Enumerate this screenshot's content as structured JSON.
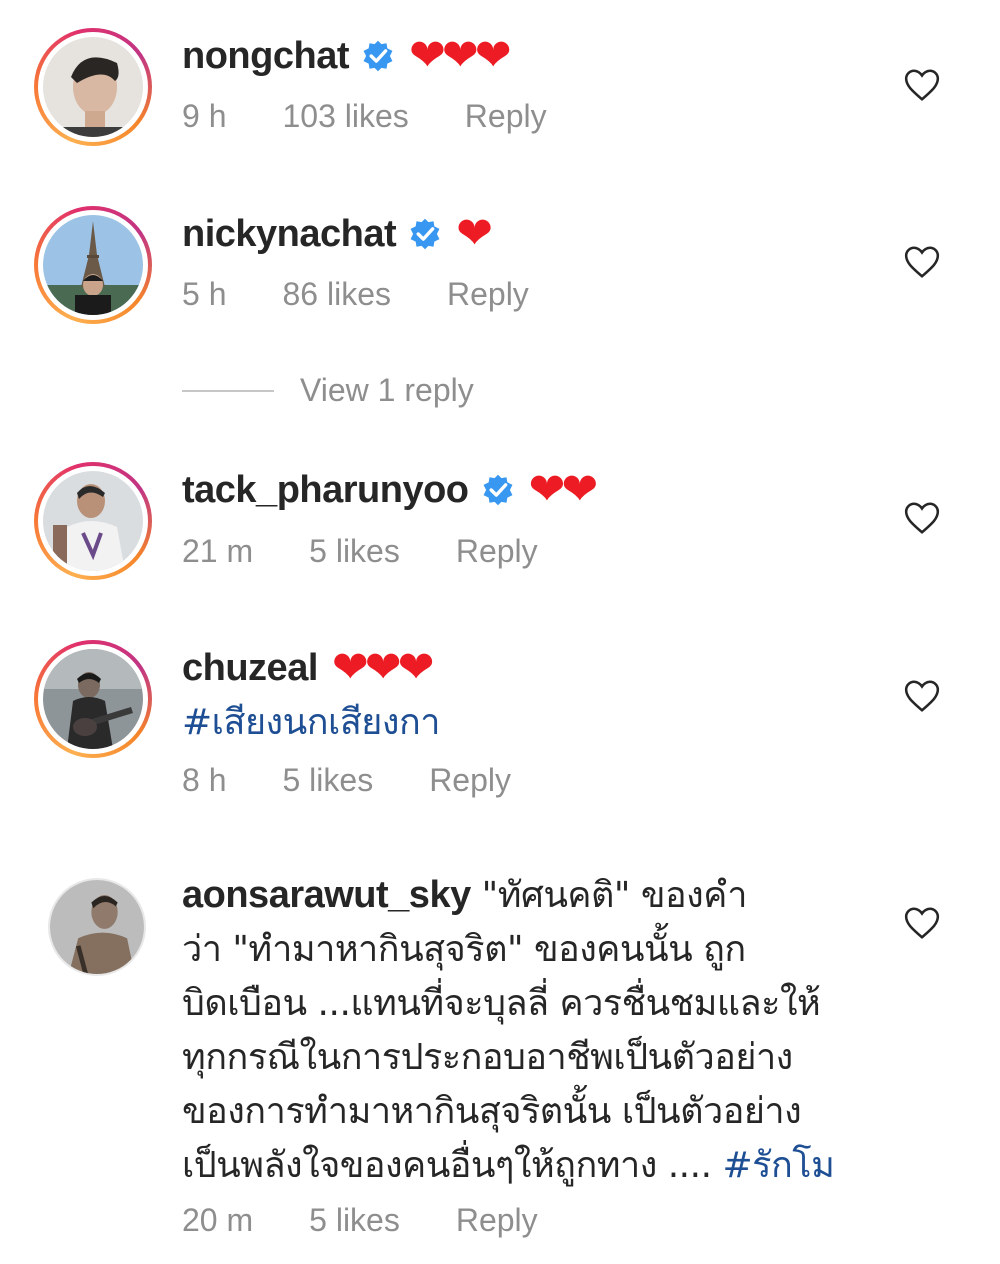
{
  "comments": [
    {
      "username": "nongchat",
      "verified": true,
      "text": "❤❤❤",
      "time": "9 h",
      "likes": "103 likes",
      "reply": "Reply"
    },
    {
      "username": "nickynachat",
      "verified": true,
      "text": "❤",
      "time": "5 h",
      "likes": "86 likes",
      "reply": "Reply",
      "view_replies": "View 1 reply"
    },
    {
      "username": "tack_pharunyoo",
      "verified": true,
      "text": "❤❤",
      "time": "21 m",
      "likes": "5 likes",
      "reply": "Reply"
    },
    {
      "username": "chuzeal",
      "verified": false,
      "text": "❤❤❤",
      "hashtag": "#เสียงนกเสียงกา",
      "time": "8 h",
      "likes": "5 likes",
      "reply": "Reply"
    },
    {
      "username": "aonsarawut_sky",
      "verified": false,
      "text_lines": [
        "\"ทัศนคติ\" ของคำ",
        "ว่า \"ทำมาหากินสุจริต\" ของคนนั้น ถูก",
        "บิดเบือน ...แทนที่จะบุลลี่ ควรชื่นชมและให้",
        "ทุกกรณีในการประกอบอาชีพเป็นตัวอย่าง",
        "ของการทำมาหากินสุจริตนั้น เป็นตัวอย่าง",
        "เป็นพลังใจของคนอื่นๆให้ถูกทาง .... "
      ],
      "hashtag": "#รักโม",
      "time": "20 m",
      "likes": "5 likes",
      "reply": "Reply"
    }
  ],
  "icons": {
    "verified": "verified-badge-icon",
    "like": "heart-outline-icon",
    "accent": "#3897f0",
    "heart_color": "#ed1c24",
    "hashtag_color": "#1e4e93"
  }
}
